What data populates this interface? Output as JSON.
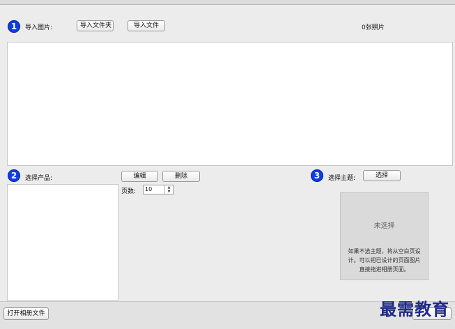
{
  "import_section": {
    "step": "1",
    "label": "导入图片:",
    "import_folder_button": "导入文件夹",
    "import_file_button": "导入文件",
    "photo_count": "0张照片"
  },
  "product_section": {
    "step": "2",
    "label": "选择产品:",
    "edit_button": "编辑",
    "delete_button": "删除",
    "pages_label": "页数:",
    "pages_value": "10"
  },
  "theme_section": {
    "step": "3",
    "label": "选择主题:",
    "select_button": "选择",
    "status": "未选择",
    "hint": "如果不选主题，将从空白页设计。可以把已设计的页面图片直接拖进相册页面。"
  },
  "footer": {
    "open_album_button": "打开相册文件",
    "watermark": "最需教育"
  },
  "colors": {
    "step_circle": "#0f3de0",
    "watermark": "#1e2a86"
  }
}
